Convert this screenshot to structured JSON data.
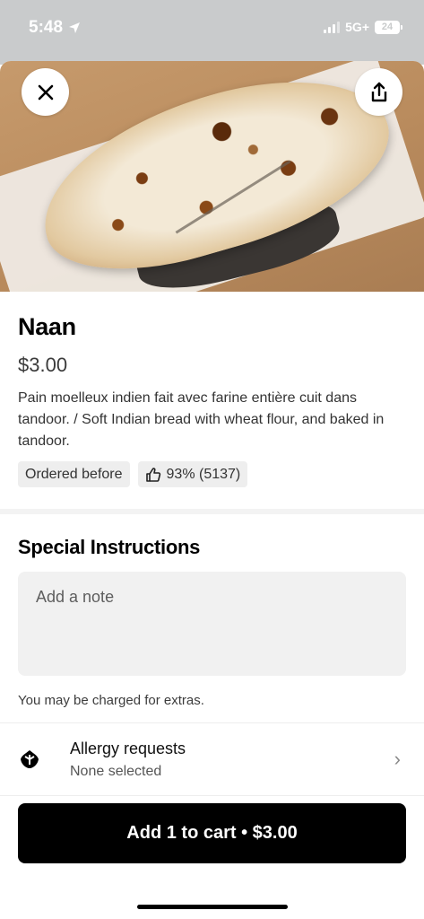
{
  "status_bar": {
    "time": "5:48",
    "network": "5G+",
    "battery": "24"
  },
  "item": {
    "name": "Naan",
    "price": "$3.00",
    "description": "Pain moelleux indien fait avec farine entière cuit dans tandoor. / Soft Indian bread with wheat flour, and baked in tandoor.",
    "badges": {
      "ordered_before": "Ordered before",
      "rating": "93% (5137)"
    }
  },
  "special_instructions": {
    "title": "Special Instructions",
    "placeholder": "Add a note",
    "charge_note": "You may be charged for extras."
  },
  "allergy": {
    "title": "Allergy requests",
    "subtitle": "None selected"
  },
  "cart_button": {
    "label": "Add 1 to cart • $3.00"
  },
  "icons": {
    "close": "close-icon",
    "share": "share-icon",
    "thumbs_up": "thumbs-up-icon",
    "allergy": "allergy-icon",
    "chevron": "chevron-right-icon",
    "location": "location-arrow-icon"
  },
  "colors": {
    "primary_button": "#000000",
    "chip_background": "#eeeeee",
    "input_background": "#f1f1f1"
  }
}
